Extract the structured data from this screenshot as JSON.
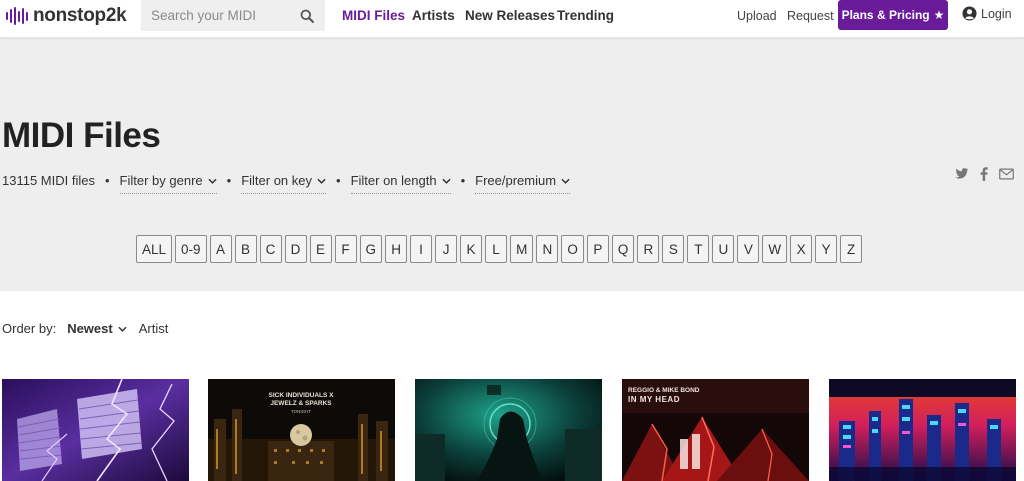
{
  "brand": {
    "name": "nonstop2k",
    "accent": "#6a1b9a"
  },
  "search": {
    "placeholder": "Search your MIDI"
  },
  "nav": {
    "links": [
      "MIDI Files",
      "Artists",
      "New Releases",
      "Trending"
    ],
    "active": "MIDI Files",
    "upload": "Upload",
    "request": "Request",
    "plans": "Plans & Pricing",
    "login": "Login"
  },
  "page": {
    "title": "MIDI Files",
    "count": "13115 MIDI files",
    "filters": [
      "Filter by genre",
      "Filter on key",
      "Filter on length",
      "Free/premium"
    ]
  },
  "share_icons": [
    "twitter-icon",
    "facebook-icon",
    "mail-icon"
  ],
  "alphabet": [
    "ALL",
    "0-9",
    "A",
    "B",
    "C",
    "D",
    "E",
    "F",
    "G",
    "H",
    "I",
    "J",
    "K",
    "L",
    "M",
    "N",
    "O",
    "P",
    "Q",
    "R",
    "S",
    "T",
    "U",
    "V",
    "W",
    "X",
    "Y",
    "Z"
  ],
  "order": {
    "label": "Order by:",
    "selected": "Newest",
    "other": "Artist"
  },
  "cards": [
    {
      "art": "purple-lightning-building-artwork"
    },
    {
      "art": "dark-city-moon-artwork",
      "line1": "SICK INDIVIDUALS X",
      "line2": "JEWELZ & SPARKS",
      "line3": "TONIGHT"
    },
    {
      "art": "green-hooded-figure-artwork"
    },
    {
      "art": "red-mountains-artwork",
      "line1": "REGGIO & MIKE BOND",
      "line2": "IN MY HEAD"
    },
    {
      "art": "neon-cityscape-artwork"
    }
  ]
}
